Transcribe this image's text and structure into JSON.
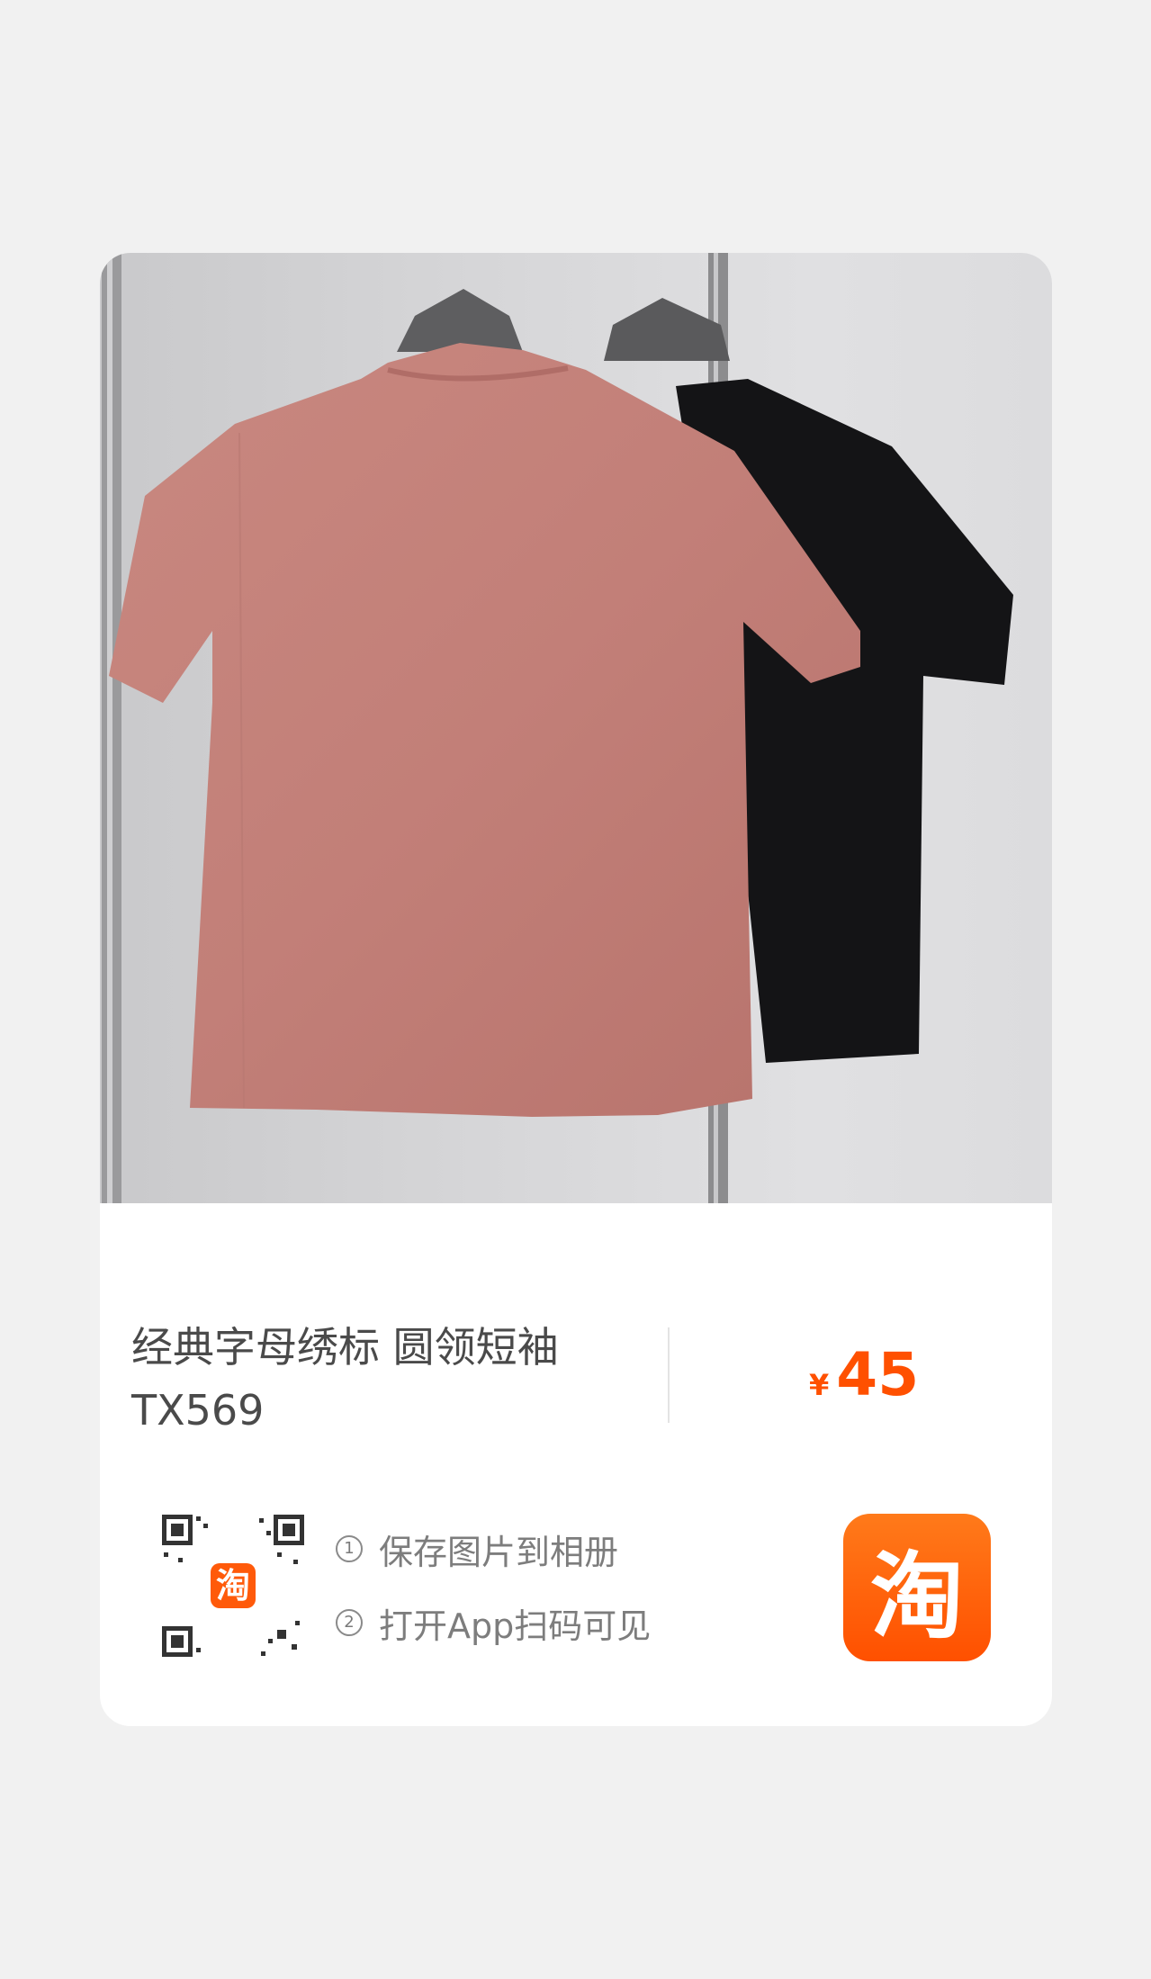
{
  "product": {
    "title": "经典字母绣标 圆领短袖 TX569",
    "currency_symbol": "¥",
    "price": "45",
    "image_icon": "tshirt-photo"
  },
  "share": {
    "steps": [
      {
        "num": "1",
        "text": "保存图片到相册"
      },
      {
        "num": "2",
        "text": "打开App扫码可见"
      }
    ],
    "qr_center_glyph": "淘",
    "app_logo_glyph": "淘"
  },
  "colors": {
    "accent": "#ff5000",
    "card_bg": "#ffffff",
    "page_bg": "#f1f1f1"
  }
}
